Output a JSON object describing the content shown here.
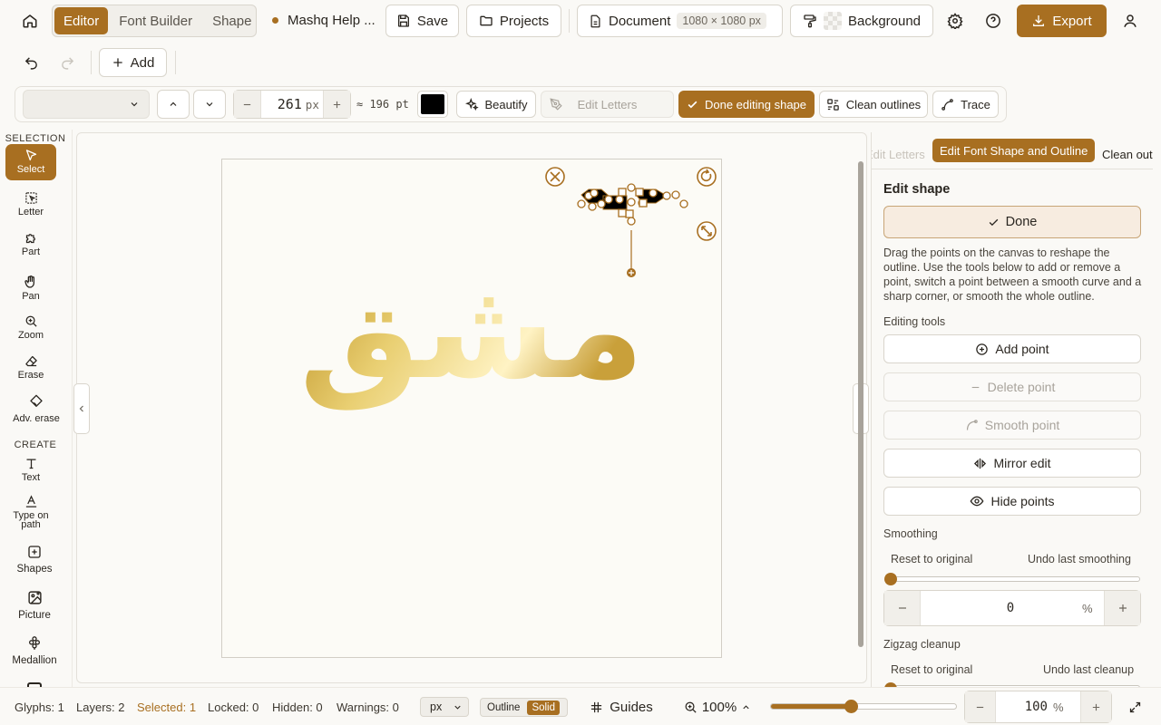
{
  "topbar": {
    "tabs": [
      "Editor",
      "Font Builder",
      "Shape Builder"
    ],
    "project_name": "Mashq Help ...",
    "save_label": "Save",
    "projects_label": "Projects",
    "document_label": "Document",
    "document_size": "1080 × 1080 px",
    "background_label": "Background",
    "export_label": "Export"
  },
  "actionbar": {
    "add_label": "Add"
  },
  "fontbar": {
    "font_value": "",
    "size_value": "261",
    "size_unit": "px",
    "pt_equiv": "≈ 196 pt",
    "fill_color": "#000000",
    "beautify_label": "Beautify",
    "edit_letters_label": "Edit Letters",
    "done_editing_label": "Done editing shape",
    "clean_outlines_label": "Clean outlines",
    "trace_label": "Trace"
  },
  "sidebar": {
    "selection_header": "SELECTION",
    "create_header": "CREATE",
    "tools": {
      "select": "Select",
      "letter": "Letter",
      "part": "Part",
      "pan": "Pan",
      "zoom": "Zoom",
      "erase": "Erase",
      "adv_erase": "Adv. erase",
      "text": "Text",
      "type_on_path": "Type on path",
      "shapes": "Shapes",
      "picture": "Picture",
      "medallion": "Medallion"
    }
  },
  "canvas": {
    "artwork_text": "مشق",
    "gradient_colors": [
      "#b88a1c",
      "#e9cf72",
      "#fff3c4",
      "#c9a03a"
    ],
    "accent": "#a86f21"
  },
  "panel": {
    "tabs": [
      "Edit Letters",
      "Edit Font Shape and Outline",
      "Clean out"
    ],
    "section_title": "Edit shape",
    "done_label": "Done",
    "description": "Drag the points on the canvas to reshape the outline. Use the tools below to add or remove a point, switch a point between a smooth curve and a sharp corner, or smooth the whole outline.",
    "editing_tools_label": "Editing tools",
    "add_point_label": "Add point",
    "delete_point_label": "Delete point",
    "smooth_point_label": "Smooth point",
    "mirror_edit_label": "Mirror edit",
    "hide_points_label": "Hide points",
    "smoothing_label": "Smoothing",
    "reset_original_label": "Reset to original",
    "undo_smoothing_label": "Undo last smoothing",
    "smoothing_value": "0",
    "smoothing_unit": "%",
    "zigzag_label": "Zigzag cleanup",
    "reset_original_label_2": "Reset to original",
    "undo_cleanup_label": "Undo last cleanup"
  },
  "status": {
    "glyphs": "Glyphs: 1",
    "layers": "Layers: 2",
    "selected": "Selected: 1",
    "locked": "Locked: 0",
    "hidden": "Hidden: 0",
    "warnings": "Warnings: 0",
    "unit_option": "px",
    "outline_label": "Outline",
    "solid_label": "Solid",
    "guides_label": "Guides",
    "zoom_readout": "100%",
    "zoom_fraction": 0.43,
    "zoom_value": "100",
    "zoom_unit": "%"
  }
}
